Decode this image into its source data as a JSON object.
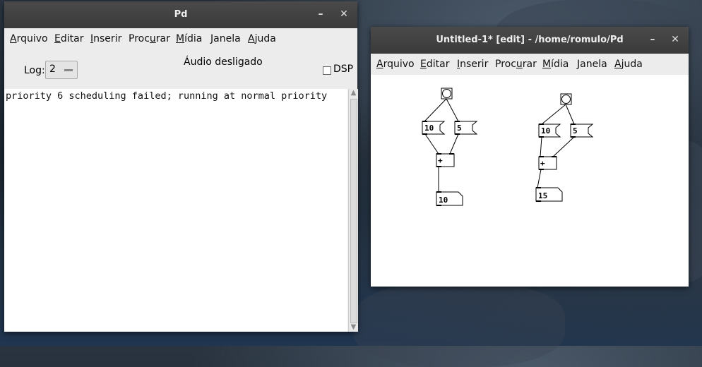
{
  "main_window": {
    "title": "Pd",
    "minimize": "–",
    "close": "✕",
    "menu": [
      "Arquivo",
      "Editar",
      "Inserir",
      "Procurar",
      "Mídia",
      "Janela",
      "Ajuda"
    ],
    "log_label": "Log:",
    "log_level": "2",
    "audio_status": "Áudio desligado",
    "dsp_label": "DSP",
    "dsp_checked": false,
    "console_lines": [
      "priority 6 scheduling failed; running at normal priority"
    ]
  },
  "patch_window": {
    "title": "Untitled-1* [edit] - /home/romulo/Pd",
    "minimize": "–",
    "close": "✕",
    "menu": [
      "Arquivo",
      "Editar",
      "Inserir",
      "Procurar",
      "Mídia",
      "Janela",
      "Ajuda"
    ],
    "patch1": {
      "msg_a": "10",
      "msg_b": "5",
      "op": "+",
      "result": "10"
    },
    "patch2": {
      "msg_a": "10",
      "msg_b": "5",
      "op": "+",
      "result": "15"
    }
  }
}
